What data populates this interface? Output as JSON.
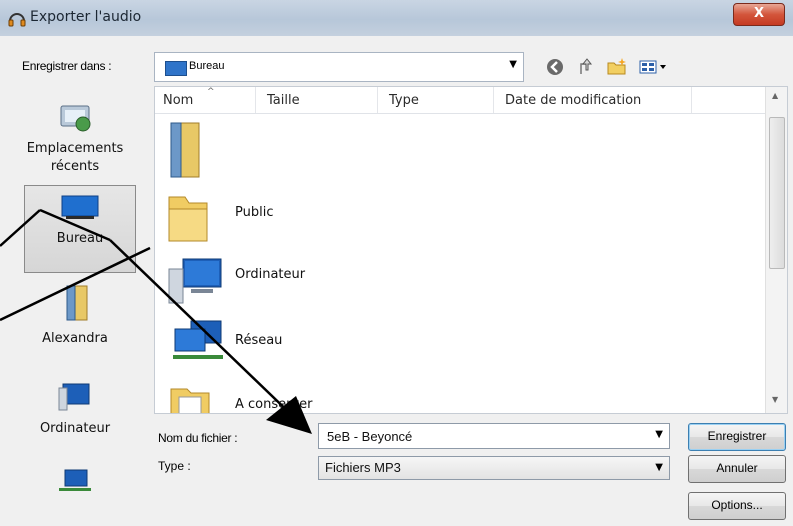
{
  "window": {
    "title": "Exporter l'audio",
    "close_label": "X"
  },
  "address_bar": {
    "label": "Enregistrer dans :",
    "location": "Bureau"
  },
  "toolbar": {
    "icons": [
      "back-icon",
      "up-folder-icon",
      "new-folder-icon",
      "view-menu-icon"
    ]
  },
  "list": {
    "columns": [
      "Nom",
      "Taille",
      "Type",
      "Date de modification"
    ],
    "items": [
      {
        "label": "",
        "icon": "user-folder-icon"
      },
      {
        "label": "Public",
        "icon": "folder-icon"
      },
      {
        "label": "Ordinateur",
        "icon": "computer-icon"
      },
      {
        "label": "Réseau",
        "icon": "network-icon"
      },
      {
        "label": "A conserver",
        "icon": "folder-icon"
      }
    ]
  },
  "sidebar": {
    "items": [
      {
        "label": "Emplacements récents",
        "icon": "recent-places-icon"
      },
      {
        "label": "Bureau",
        "icon": "desktop-icon"
      },
      {
        "label": "Alexandra",
        "icon": "user-folder-icon"
      },
      {
        "label": "Ordinateur",
        "icon": "computer-icon"
      },
      {
        "label": "",
        "icon": "network-icon"
      }
    ]
  },
  "form": {
    "filename_label": "Nom du fichier :",
    "filename_value": "5eB - Beyoncé",
    "type_label": "Type :",
    "type_value": "Fichiers MP3"
  },
  "buttons": {
    "save": "Enregistrer",
    "cancel": "Annuler",
    "options": "Options..."
  },
  "colors": {
    "accent": "#3c7fb1",
    "close": "#c53a22"
  }
}
